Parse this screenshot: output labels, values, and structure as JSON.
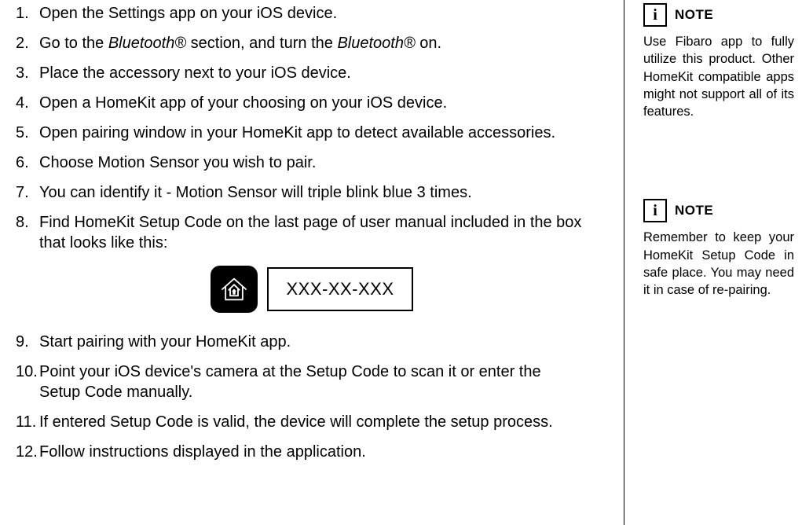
{
  "steps": [
    "Open the Settings app on your iOS device.",
    "Go to the Bluetooth® section, and turn the Bluetooth® on.",
    "Place the accessory next to your iOS device.",
    "Open a HomeKit app of your choosing on your iOS device.",
    "Open pairing window in your HomeKit app to detect available accessories.",
    "Choose Motion Sensor you wish to pair.",
    "You can identify it - Motion Sensor will triple blink blue 3 times.",
    "Find HomeKit Setup Code on the last page of user manual included in the box that looks like this:",
    "Start pairing with your HomeKit app.",
    "Point your iOS device's camera at the Setup Code to scan it or enter the Setup Code manually.",
    "If entered Setup Code is valid, the device will complete the setup process.",
    "Follow instructions displayed in the application."
  ],
  "step2_parts": {
    "a": "Go to the ",
    "b": "Bluetooth®",
    "c": " section, and turn the ",
    "d": "Bluetooth®",
    "e": " on."
  },
  "setup_code_placeholder": "XXX-XX-XXX",
  "notes": [
    {
      "icon": "i",
      "label": "NOTE",
      "body": "Use Fibaro app to fully utilize this product. Other HomeKit compatible apps might not support all of its features."
    },
    {
      "icon": "i",
      "label": "NOTE",
      "body": "Remember to keep your HomeKit Setup Code in safe place. You may need it in case of re-pairing."
    }
  ]
}
